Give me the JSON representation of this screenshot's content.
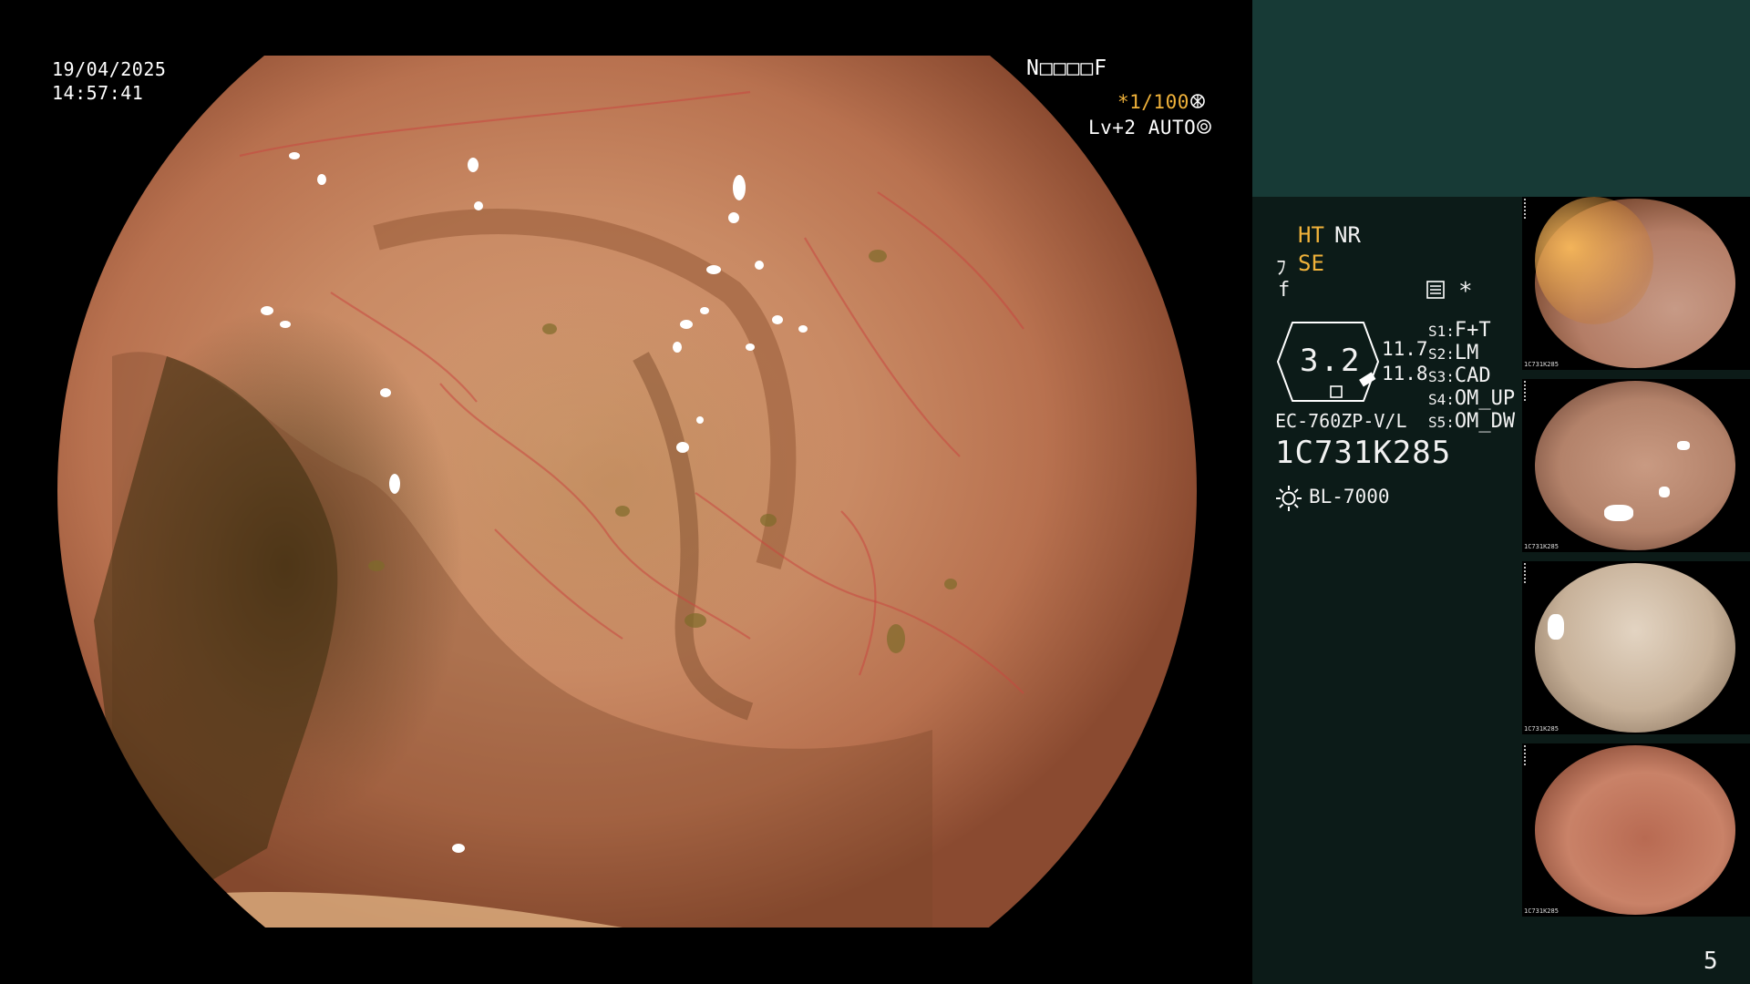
{
  "overlay": {
    "date": "19/04/2025",
    "time": "14:57:41",
    "patient_id": "N□□□□F",
    "shutter": "*1/100",
    "level": "Lv+2",
    "iris_mode": "AUTO"
  },
  "status_panel": {
    "mode_ht": "HT",
    "mode_nr": "NR",
    "mode_se": "SE",
    "glyph_se": "ﾌ",
    "glyph_f": "f",
    "asterisk": "*",
    "zoom_value": "3.2",
    "readout_a": "11.7",
    "readout_b": "11.8",
    "switches": [
      {
        "key": "S1:",
        "value": "F+T"
      },
      {
        "key": "S2:",
        "value": "LM"
      },
      {
        "key": "S3:",
        "value": "CAD"
      },
      {
        "key": "S4:",
        "value": "OM_UP"
      },
      {
        "key": "S5:",
        "value": "OM_DW"
      }
    ],
    "scope_model": "EC-760ZP-V/L",
    "scope_serial": "1C731K285",
    "light_source": "BL-7000",
    "page_number": "5",
    "header_color": "#173a36",
    "accent_color": "#f0b23a"
  },
  "thumbnails": [
    {
      "label": "1C731K285"
    },
    {
      "label": "1C731K285"
    },
    {
      "label": "1C731K285"
    },
    {
      "label": "1C731K285"
    }
  ]
}
